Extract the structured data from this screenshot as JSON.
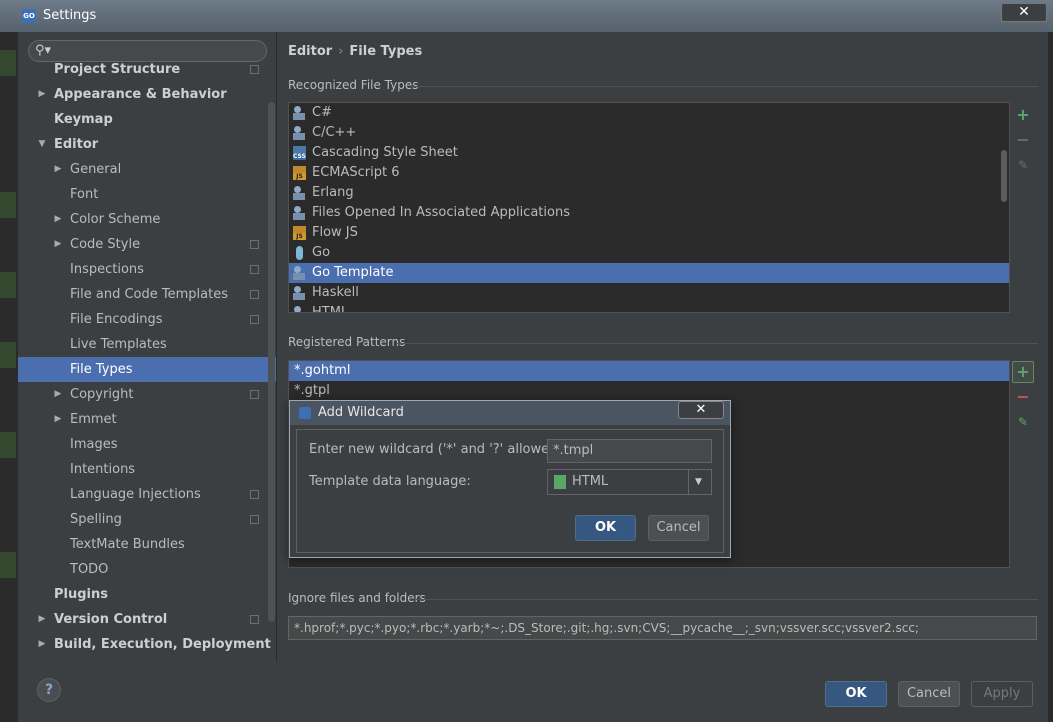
{
  "window": {
    "title": "Settings"
  },
  "sidebar": {
    "search_placeholder": "",
    "items": [
      {
        "label": "Project Structure",
        "level": 0,
        "bold": true,
        "arrow": "",
        "copy": true,
        "partial": true
      },
      {
        "label": "Appearance & Behavior",
        "level": 0,
        "bold": true,
        "arrow": "right",
        "copy": false
      },
      {
        "label": "Keymap",
        "level": 0,
        "bold": true,
        "arrow": "",
        "copy": false
      },
      {
        "label": "Editor",
        "level": 0,
        "bold": true,
        "arrow": "down",
        "copy": false
      },
      {
        "label": "General",
        "level": 1,
        "bold": false,
        "arrow": "right",
        "copy": false
      },
      {
        "label": "Font",
        "level": 1,
        "bold": false,
        "arrow": "",
        "copy": false
      },
      {
        "label": "Color Scheme",
        "level": 1,
        "bold": false,
        "arrow": "right",
        "copy": false
      },
      {
        "label": "Code Style",
        "level": 1,
        "bold": false,
        "arrow": "right",
        "copy": true
      },
      {
        "label": "Inspections",
        "level": 1,
        "bold": false,
        "arrow": "",
        "copy": true
      },
      {
        "label": "File and Code Templates",
        "level": 1,
        "bold": false,
        "arrow": "",
        "copy": true
      },
      {
        "label": "File Encodings",
        "level": 1,
        "bold": false,
        "arrow": "",
        "copy": true
      },
      {
        "label": "Live Templates",
        "level": 1,
        "bold": false,
        "arrow": "",
        "copy": false
      },
      {
        "label": "File Types",
        "level": 1,
        "bold": false,
        "arrow": "",
        "copy": false,
        "selected": true
      },
      {
        "label": "Copyright",
        "level": 1,
        "bold": false,
        "arrow": "right",
        "copy": true
      },
      {
        "label": "Emmet",
        "level": 1,
        "bold": false,
        "arrow": "right",
        "copy": false
      },
      {
        "label": "Images",
        "level": 1,
        "bold": false,
        "arrow": "",
        "copy": false
      },
      {
        "label": "Intentions",
        "level": 1,
        "bold": false,
        "arrow": "",
        "copy": false
      },
      {
        "label": "Language Injections",
        "level": 1,
        "bold": false,
        "arrow": "",
        "copy": true
      },
      {
        "label": "Spelling",
        "level": 1,
        "bold": false,
        "arrow": "",
        "copy": true
      },
      {
        "label": "TextMate Bundles",
        "level": 1,
        "bold": false,
        "arrow": "",
        "copy": false
      },
      {
        "label": "TODO",
        "level": 1,
        "bold": false,
        "arrow": "",
        "copy": false
      },
      {
        "label": "Plugins",
        "level": 0,
        "bold": true,
        "arrow": "",
        "copy": false
      },
      {
        "label": "Version Control",
        "level": 0,
        "bold": true,
        "arrow": "right",
        "copy": true
      },
      {
        "label": "Build, Execution, Deployment",
        "level": 0,
        "bold": true,
        "arrow": "right",
        "copy": false
      }
    ],
    "help_label": "?"
  },
  "breadcrumb": {
    "parent": "Editor",
    "separator": "›",
    "current": "File Types"
  },
  "recognized": {
    "title": "Recognized File Types",
    "items": [
      {
        "label": "C#",
        "icon": "generic"
      },
      {
        "label": "C/C++",
        "icon": "generic"
      },
      {
        "label": "Cascading Style Sheet",
        "icon": "css"
      },
      {
        "label": "ECMAScript 6",
        "icon": "js"
      },
      {
        "label": "Erlang",
        "icon": "generic"
      },
      {
        "label": "Files Opened In Associated Applications",
        "icon": "generic"
      },
      {
        "label": "Flow JS",
        "icon": "js"
      },
      {
        "label": "Go",
        "icon": "go"
      },
      {
        "label": "Go Template",
        "icon": "generic",
        "selected": true
      },
      {
        "label": "Haskell",
        "icon": "generic"
      },
      {
        "label": "HTML",
        "icon": "generic"
      }
    ],
    "icon_badges": {
      "css": "CSS",
      "js": "JS"
    }
  },
  "patterns": {
    "title": "Registered Patterns",
    "items": [
      {
        "label": "*.gohtml",
        "selected": true
      },
      {
        "label": "*.gtpl",
        "selected": false
      }
    ]
  },
  "toolbar": {
    "add": "+",
    "remove": "−",
    "edit": "✎"
  },
  "ignore": {
    "title": "Ignore files and folders",
    "value": "*.hprof;*.pyc;*.pyo;*.rbc;*.yarb;*~;.DS_Store;.git;.hg;.svn;CVS;__pycache__;_svn;vssver.scc;vssver2.scc;"
  },
  "buttons": {
    "ok": "OK",
    "cancel": "Cancel",
    "apply": "Apply"
  },
  "popup": {
    "title": "Add Wildcard",
    "close": "✕",
    "wildcard_label": "Enter new wildcard ('*' and '?' allowed):",
    "wildcard_value": "*.tmpl",
    "language_label": "Template data language:",
    "language_value": "HTML",
    "ok": "OK",
    "cancel": "Cancel"
  },
  "colors": {
    "selection": "#4b6eaf",
    "add": "#59a869",
    "remove": "#c75450",
    "primary_button": "#365880"
  }
}
